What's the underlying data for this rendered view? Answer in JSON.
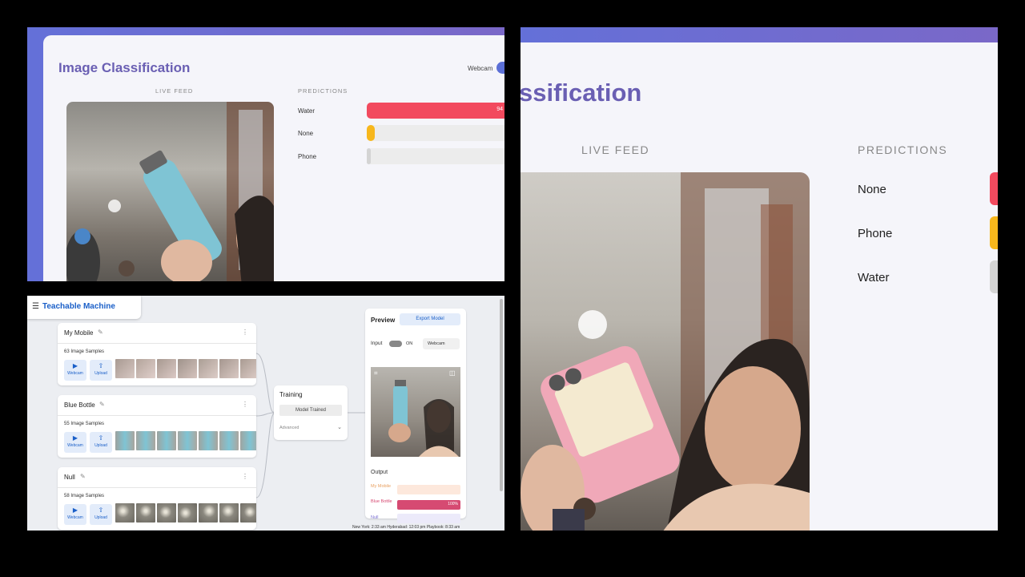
{
  "colors": {
    "accent": "#6a5fb3",
    "gradient": "#6470d8",
    "water": "#f24a5e",
    "none": "#f7b71c",
    "phone": "#d4d4d4",
    "tm_blue": "#1a5fc8"
  },
  "classifier_zoomed_out": {
    "title": "Image Classification",
    "toggle_label": "Webcam",
    "live_feed_label": "LIVE FEED",
    "predictions_label": "PREDICTIONS",
    "predictions": [
      {
        "label": "Water",
        "value_text": "94",
        "level": 0.94
      },
      {
        "label": "None",
        "value_text": "",
        "level": 0.05
      },
      {
        "label": "Phone",
        "value_text": "",
        "level": 0.01
      }
    ]
  },
  "teachable_machine": {
    "brand": "Teachable Machine",
    "classes": [
      {
        "name": "My Mobile",
        "samples": "63 Image Samples"
      },
      {
        "name": "Blue Bottle",
        "samples": "55 Image Samples"
      },
      {
        "name": "Null",
        "samples": "58 Image Samples"
      }
    ],
    "webcam_btn": "Webcam",
    "upload_btn": "Upload",
    "training": {
      "title": "Training",
      "status": "Model Trained",
      "advanced": "Advanced"
    },
    "preview": {
      "title": "Preview",
      "export": "Export Model",
      "input_label": "Input",
      "input_state": "ON",
      "source": "Webcam",
      "output_label": "Output",
      "outputs": [
        {
          "label": "My Mobile",
          "value_text": "",
          "color": "#e8a060"
        },
        {
          "label": "Blue Bottle",
          "value_text": "100%",
          "color": "#d64a72"
        },
        {
          "label": "Null",
          "value_text": "",
          "color": "#7a6fd1"
        }
      ]
    },
    "taskbar": "New York: 2:33 am   Hyderabad: 12:03 pm   Playbook: 8:33 am"
  },
  "classifier_zoomed_in": {
    "title_fragment": "ssification",
    "live_feed_label": "LIVE FEED",
    "predictions_label": "PREDICTIONS",
    "predictions": [
      {
        "label": "None"
      },
      {
        "label": "Phone"
      },
      {
        "label": "Water"
      }
    ]
  }
}
